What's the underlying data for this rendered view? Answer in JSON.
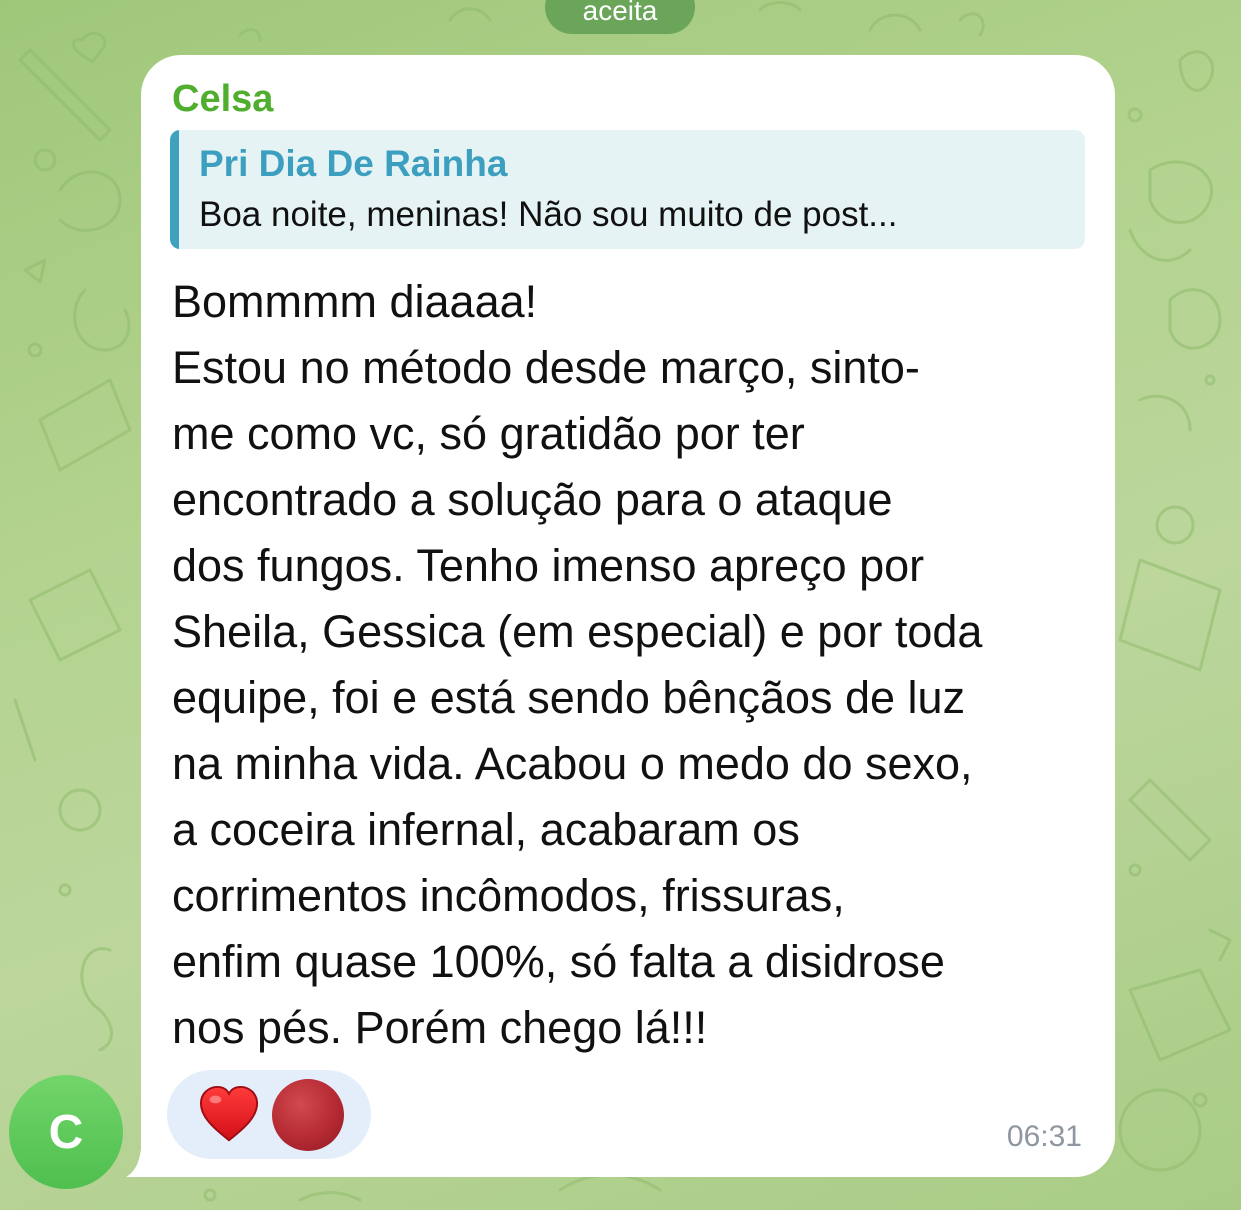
{
  "service_message": "aceita",
  "avatar": {
    "initial": "C",
    "color": "#5cc95a"
  },
  "message": {
    "sender": "Celsa",
    "sender_color": "#4fae2e",
    "reply": {
      "author": "Pri Dia De Rainha",
      "preview": "Boa noite, meninas! Não sou muito de post..."
    },
    "lines": [
      "Bommmm diaaaa!",
      "Estou no método desde março,  sinto-",
      "me como vc, só gratidão por ter",
      "encontrado a solução para o ataque",
      "dos fungos. Tenho imenso apreço por",
      "Sheila, Gessica (em especial) e por toda",
      "equipe, foi e está sendo bênçãos de luz",
      "na minha vida. Acabou o medo do sexo,",
      "a coceira infernal, acabaram os",
      "corrimentos incômodos, frissuras,",
      "enfim quase 100%, só falta a disidrose",
      "nos pés. Porém chego lá!!!"
    ],
    "reactions": [
      {
        "emoji": "heart-icon"
      },
      {
        "reactor_avatar": "reactor-avatar"
      }
    ],
    "time": "06:31"
  },
  "colors": {
    "wallpaper": "#b3d38f",
    "bubble": "#ffffff",
    "reply_bar": "#3ea2bf",
    "reply_bg": "#e6f3f5",
    "reaction_bg": "#e3eefa",
    "timestamp": "#8e979f"
  }
}
